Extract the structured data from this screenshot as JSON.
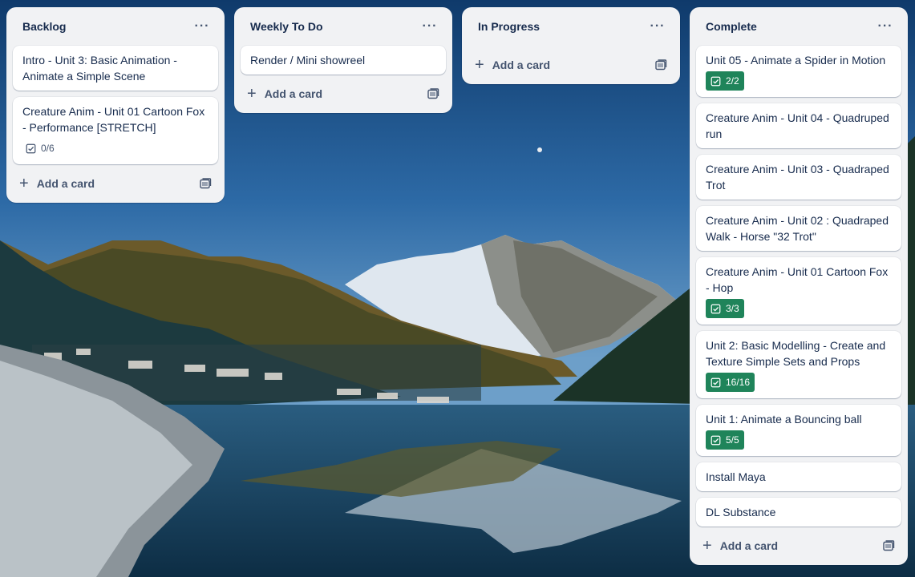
{
  "lists": [
    {
      "title": "Backlog",
      "menu_label": "···",
      "cards": [
        {
          "title": "Intro - Unit 3: Basic Animation - Animate a Simple Scene"
        },
        {
          "title": "Creature Anim - Unit 01 Cartoon Fox - Performance [STRETCH]",
          "checklist": "0/6",
          "checklist_done": false
        }
      ],
      "add_label": "Add a card"
    },
    {
      "title": "Weekly To Do",
      "menu_label": "···",
      "cards": [
        {
          "title": "Render / Mini showreel"
        }
      ],
      "add_label": "Add a card"
    },
    {
      "title": "In Progress",
      "menu_label": "···",
      "cards": [],
      "add_label": "Add a card"
    },
    {
      "title": "Complete",
      "menu_label": "···",
      "cards": [
        {
          "title": "Unit 05 - Animate a Spider in Motion",
          "checklist": "2/2",
          "checklist_done": true
        },
        {
          "title": "Creature Anim - Unit 04 - Quadruped run"
        },
        {
          "title": "Creature Anim - Unit 03 - Quadraped Trot"
        },
        {
          "title": "Creature Anim - Unit 02 : Quadraped Walk - Horse \"32 Trot\""
        },
        {
          "title": "Creature Anim - Unit 01 Cartoon Fox - Hop",
          "checklist": "3/3",
          "checklist_done": true
        },
        {
          "title": "Unit 2: Basic Modelling - Create and Texture Simple Sets and Props",
          "checklist": "16/16",
          "checklist_done": true
        },
        {
          "title": "Unit 1: Animate a Bouncing ball",
          "checklist": "5/5",
          "checklist_done": true
        },
        {
          "title": "Install Maya"
        },
        {
          "title": "DL Substance"
        }
      ],
      "add_label": "Add a card"
    }
  ],
  "colors": {
    "list_bg": "#f1f2f4",
    "badge_done": "#1f845a",
    "text": "#172b4d",
    "subtle": "#44546f"
  },
  "icons": {
    "menu": "ellipsis-icon",
    "checklist": "checklist-icon",
    "add": "plus-icon",
    "template": "card-template-icon"
  }
}
